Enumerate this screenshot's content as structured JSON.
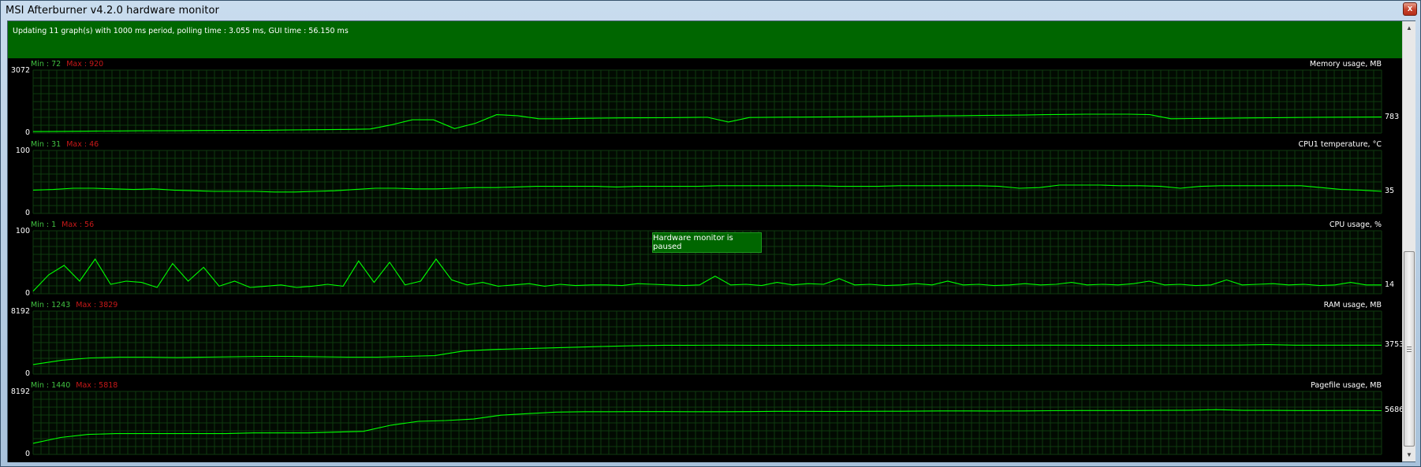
{
  "window": {
    "title": "MSI Afterburner v4.2.0 hardware monitor",
    "close_label": "x"
  },
  "status": {
    "text": "Updating 11 graph(s) with 1000 ms period, polling time : 3.055 ms, GUI time : 56.150 ms"
  },
  "paused_message": "Hardware monitor is paused",
  "colors": {
    "status_bg": "#006600",
    "graph_bg": "#000000",
    "grid": "#0f3a0f",
    "line": "#00ff00",
    "min_text": "#40c040",
    "max_text": "#c81818"
  },
  "chart_data": [
    {
      "type": "line",
      "title": "Memory usage, MB",
      "min_label": "Min : 72",
      "max_label": "Max : 920",
      "ylim": [
        0,
        3072
      ],
      "y_top_label": "3072",
      "y_bottom_label": "0",
      "current_label": "783",
      "series": [
        {
          "values": [
            72,
            80,
            90,
            100,
            105,
            110,
            115,
            120,
            125,
            130,
            135,
            140,
            150,
            160,
            170,
            180,
            200,
            400,
            650,
            650,
            220,
            480,
            900,
            850,
            700,
            700,
            720,
            730,
            740,
            745,
            750,
            760,
            770,
            540,
            760,
            770,
            780,
            785,
            790,
            800,
            810,
            820,
            830,
            840,
            850,
            860,
            870,
            880,
            900,
            910,
            920,
            920,
            920,
            900,
            700,
            710,
            720,
            730,
            740,
            750,
            760,
            770,
            775,
            780,
            783
          ]
        }
      ]
    },
    {
      "type": "line",
      "title": "CPU1 temperature, °C",
      "min_label": "Min : 31",
      "max_label": "Max : 46",
      "ylim": [
        0,
        100
      ],
      "y_top_label": "100",
      "y_bottom_label": "0",
      "current_label": "35",
      "series": [
        {
          "values": [
            37,
            38,
            40,
            40,
            39,
            38,
            39,
            37,
            36,
            35,
            35,
            35,
            34,
            34,
            35,
            36,
            38,
            40,
            40,
            39,
            39,
            40,
            41,
            41,
            42,
            43,
            43,
            43,
            43,
            42,
            43,
            43,
            43,
            43,
            44,
            44,
            44,
            44,
            44,
            44,
            43,
            43,
            43,
            44,
            44,
            44,
            44,
            44,
            43,
            40,
            41,
            45,
            45,
            45,
            44,
            44,
            43,
            40,
            43,
            44,
            44,
            44,
            44,
            44,
            41,
            38,
            37,
            35
          ]
        }
      ]
    },
    {
      "type": "line",
      "title": "CPU usage, %",
      "min_label": "Min : 1",
      "max_label": "Max : 56",
      "ylim": [
        0,
        100
      ],
      "y_top_label": "100",
      "y_bottom_label": "0",
      "current_label": "14",
      "series": [
        {
          "values": [
            4,
            30,
            45,
            20,
            55,
            15,
            20,
            18,
            10,
            48,
            20,
            42,
            12,
            20,
            10,
            12,
            14,
            10,
            12,
            15,
            12,
            52,
            18,
            50,
            14,
            20,
            55,
            22,
            14,
            18,
            12,
            14,
            16,
            12,
            15,
            13,
            14,
            14,
            13,
            16,
            15,
            14,
            13,
            14,
            28,
            14,
            15,
            13,
            18,
            14,
            16,
            15,
            24,
            14,
            15,
            13,
            14,
            16,
            14,
            20,
            14,
            15,
            13,
            14,
            16,
            14,
            15,
            18,
            14,
            15,
            14,
            16,
            20,
            14,
            15,
            13,
            14,
            22,
            14,
            15,
            16,
            14,
            15,
            13,
            14,
            18,
            14,
            14
          ]
        }
      ]
    },
    {
      "type": "line",
      "title": "RAM usage, MB",
      "min_label": "Min : 1243",
      "max_label": "Max : 3829",
      "ylim": [
        0,
        8192
      ],
      "y_top_label": "8192",
      "y_bottom_label": "0",
      "current_label": "3753",
      "series": [
        {
          "values": [
            1243,
            1800,
            2100,
            2200,
            2200,
            2150,
            2200,
            2250,
            2300,
            2300,
            2250,
            2200,
            2200,
            2300,
            2400,
            3000,
            3200,
            3300,
            3400,
            3500,
            3600,
            3700,
            3750,
            3750,
            3760,
            3750,
            3750,
            3750,
            3760,
            3760,
            3750,
            3750,
            3760,
            3750,
            3750,
            3760,
            3760,
            3750,
            3750,
            3760,
            3760,
            3760,
            3770,
            3829,
            3760,
            3760,
            3760,
            3753
          ]
        }
      ]
    },
    {
      "type": "line",
      "title": "Pagefile usage, MB",
      "min_label": "Min : 1440",
      "max_label": "Max : 5818",
      "ylim": [
        0,
        8192
      ],
      "y_top_label": "8192",
      "y_bottom_label": "0",
      "current_label": "5686",
      "series": [
        {
          "values": [
            1440,
            2200,
            2600,
            2700,
            2700,
            2700,
            2700,
            2700,
            2800,
            2800,
            2800,
            2900,
            3000,
            3800,
            4300,
            4400,
            4600,
            5100,
            5300,
            5500,
            5550,
            5550,
            5560,
            5560,
            5550,
            5550,
            5560,
            5600,
            5600,
            5590,
            5600,
            5610,
            5620,
            5650,
            5650,
            5640,
            5650,
            5680,
            5700,
            5700,
            5700,
            5720,
            5740,
            5818,
            5720,
            5720,
            5700,
            5700,
            5710,
            5686
          ]
        }
      ]
    }
  ]
}
